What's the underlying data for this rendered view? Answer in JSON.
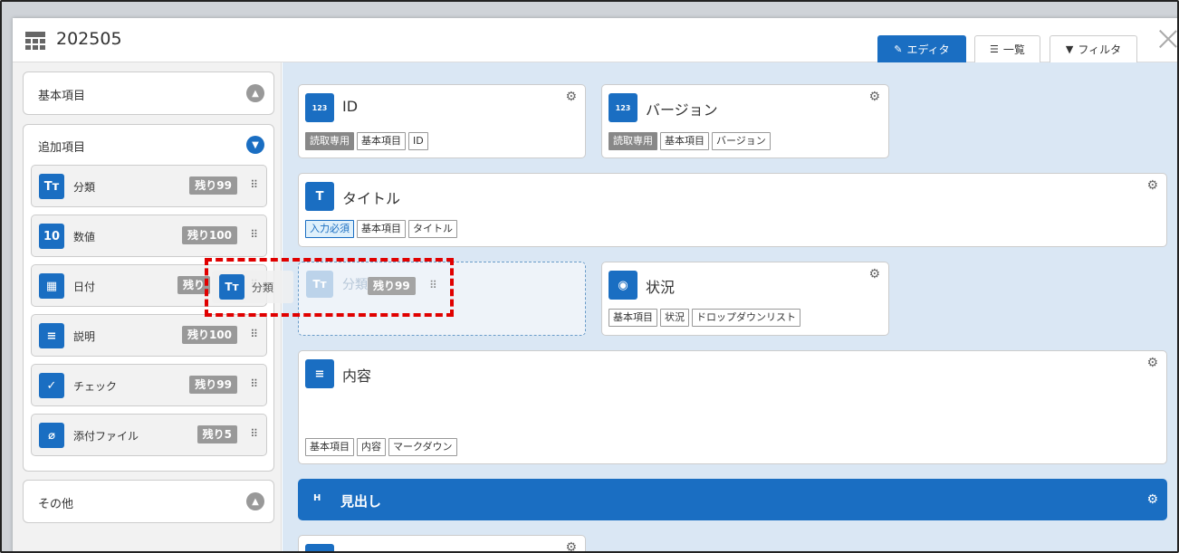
{
  "header": {
    "title": "202505"
  },
  "tabs": [
    {
      "label": "エディタ",
      "icon": "edit-icon",
      "active": true
    },
    {
      "label": "一覧",
      "icon": "list-icon",
      "active": false
    },
    {
      "label": "フィルタ",
      "icon": "filter-icon",
      "active": false
    }
  ],
  "sidebar": {
    "basic": {
      "title": "基本項目"
    },
    "extra": {
      "title": "追加項目",
      "items": [
        {
          "icon_text": "Tт",
          "icon": "text-type-icon",
          "label": "分類",
          "remain": "残り99"
        },
        {
          "icon_text": "10",
          "icon": "number-icon",
          "label": "数値",
          "remain": "残り100"
        },
        {
          "icon_text": "▦",
          "icon": "calendar-icon",
          "label": "日付",
          "remain": "残り"
        },
        {
          "icon_text": "≡",
          "icon": "description-icon",
          "label": "説明",
          "remain": "残り100"
        },
        {
          "icon_text": "✓",
          "icon": "check-icon",
          "label": "チェック",
          "remain": "残り99"
        },
        {
          "icon_text": "⌀",
          "icon": "paperclip-icon",
          "label": "添付ファイル",
          "remain": "残り5"
        }
      ]
    },
    "other": {
      "title": "その他"
    }
  },
  "cards": {
    "id": {
      "icon_text": "123",
      "title": "ID",
      "tags": [
        "読取専用",
        "基本項目",
        "ID"
      ]
    },
    "version": {
      "icon_text": "123",
      "title": "バージョン",
      "tags": [
        "読取専用",
        "基本項目",
        "バージョン"
      ]
    },
    "title_card": {
      "icon_text": "T",
      "title": "タイトル",
      "tags": [
        "入力必須",
        "基本項目",
        "タイトル"
      ]
    },
    "status": {
      "icon_text": "◉",
      "title": "状況",
      "tags": [
        "基本項目",
        "状況",
        "ドロップダウンリスト"
      ]
    },
    "content": {
      "icon_text": "≡",
      "title": "内容",
      "tags": [
        "基本項目",
        "内容",
        "マークダウン"
      ]
    },
    "heading": {
      "mark": "H",
      "title": "見出し"
    }
  },
  "drag": {
    "ghost_label": "分類",
    "ghost_remain": "残り99",
    "moving_label": "分類"
  }
}
